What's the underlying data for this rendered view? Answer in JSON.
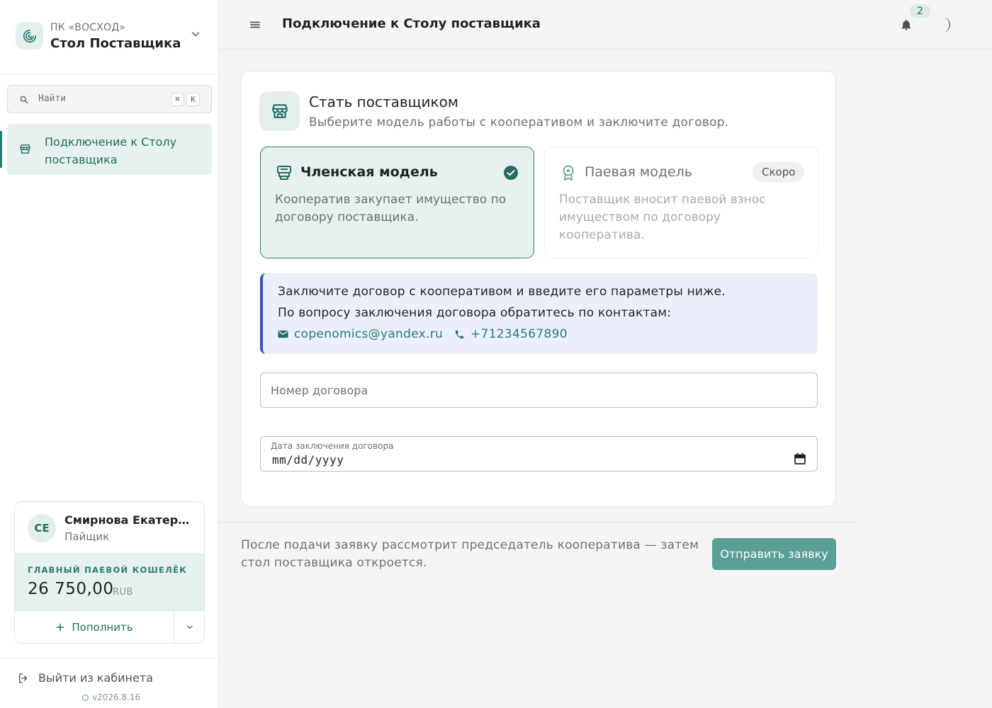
{
  "sidebar": {
    "org_subtitle": "ПК «ВОСХОД»",
    "org_name": "Стол Поставщика",
    "search": {
      "placeholder": "Найти",
      "shortcut_mod": "⌘",
      "shortcut_key": "K"
    },
    "nav_items": [
      {
        "label": "Подключение к Столу поставщика",
        "icon": "store-icon",
        "active": true
      }
    ],
    "user": {
      "initials": "СЕ",
      "name": "Смирнова Екатерина",
      "role": "Пайщик"
    },
    "wallet": {
      "label": "ГЛАВНЫЙ ПАЕВОЙ КОШЕЛЁК",
      "amount": "26 750,00",
      "currency": "RUB",
      "topup_label": "Пополнить"
    },
    "logout_label": "Выйти из кабинета",
    "version": "v2026.8.16"
  },
  "topbar": {
    "title": "Подключение к Столу поставщика",
    "notification_count": "2"
  },
  "card": {
    "title": "Стать поставщиком",
    "subtitle": "Выберите модель работы с кооперативом и заключите договор.",
    "models": [
      {
        "title": "Членская модель",
        "description": "Кооператив закупает имущество по договору поставщика.",
        "selected": true
      },
      {
        "title": "Паевая модель",
        "description": "Поставщик вносит паевой взнос имуществом по договору кооператива.",
        "badge": "Скоро",
        "disabled": true
      }
    ],
    "info": {
      "line1": "Заключите договор с кооперативом и введите его параметры ниже.",
      "line2": "По вопросу заключения договора обратитесь по контактам:",
      "email": "copenomics@yandex.ru",
      "phone": "+71234567890"
    },
    "contract_number": {
      "placeholder": "Номер договора",
      "value": ""
    },
    "contract_date": {
      "label": "Дата заключения договора",
      "value": "mm/dd/yyyy"
    }
  },
  "footer": {
    "note": "После подачи заявку рассмотрит председатель кооператива — затем стол поставщика откроется.",
    "submit_label": "Отправить заявку"
  },
  "colors": {
    "accent": "#2a7d72",
    "accent_light": "#e6f0ee",
    "info_border": "#2c52c9",
    "info_bg": "#ebeff9",
    "submit_bg": "#5a9e96"
  }
}
